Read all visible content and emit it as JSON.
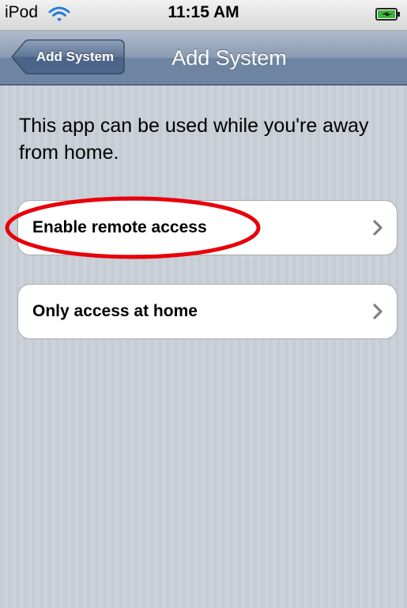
{
  "status_bar": {
    "carrier": "iPod",
    "wifi_icon": "wifi-icon",
    "time": "11:15 AM",
    "battery_icon": "battery-charging-icon"
  },
  "nav_bar": {
    "back_label": "Add System",
    "title": "Add System"
  },
  "content": {
    "intro_text": "This app can be used while you're away from home.",
    "options": [
      {
        "label": "Enable remote access",
        "icon": "chevron-right-icon",
        "highlighted": true
      },
      {
        "label": "Only access at home",
        "icon": "chevron-right-icon",
        "highlighted": false
      }
    ]
  },
  "colors": {
    "background": "#c5ccd4",
    "nav_bar": "#6d84a2",
    "highlight": "#e8000a"
  }
}
